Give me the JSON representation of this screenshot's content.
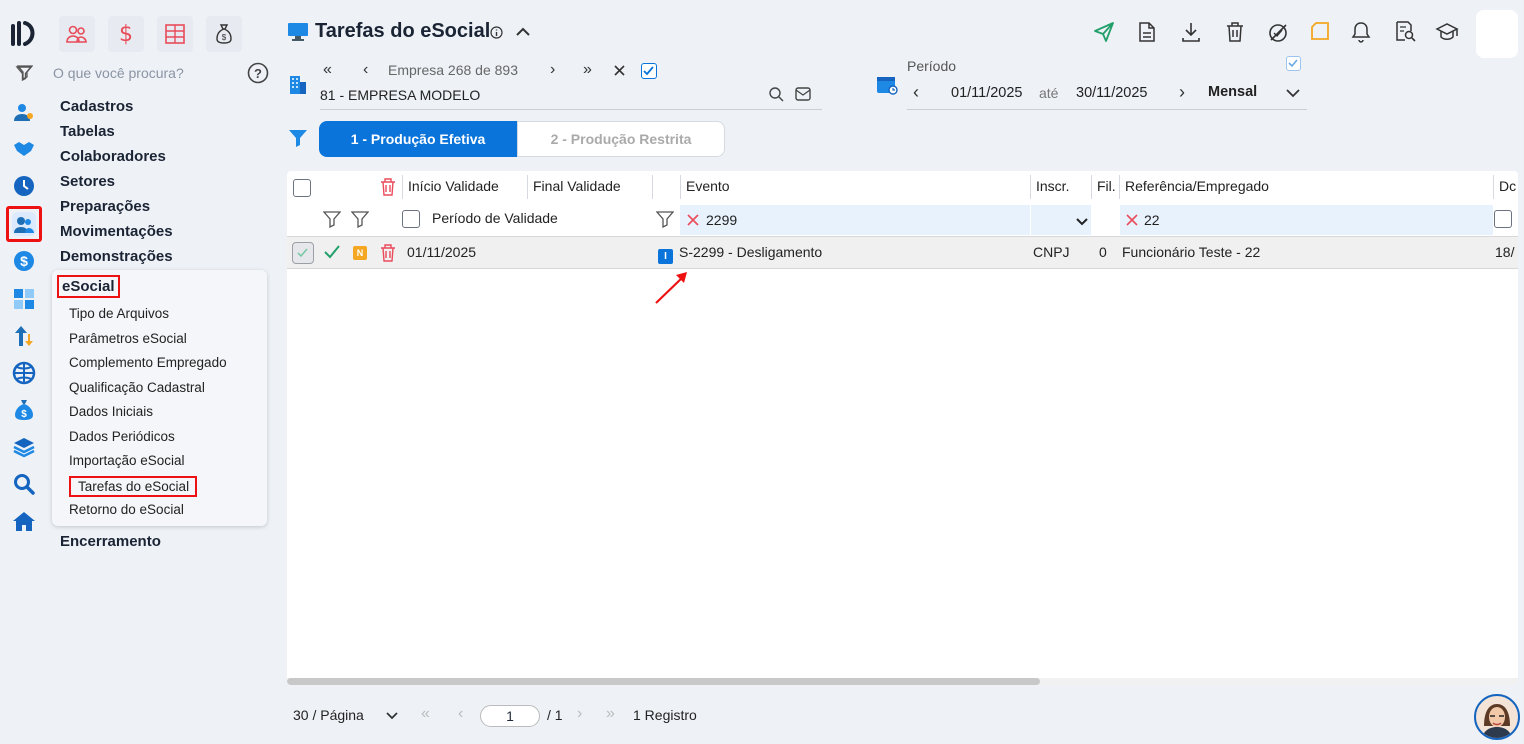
{
  "sidebar": {
    "search_placeholder": "O que você procura?",
    "menu": [
      "Cadastros",
      "Tabelas",
      "Colaboradores",
      "Setores",
      "Preparações",
      "Movimentações",
      "Demonstrações"
    ],
    "esocial_label": "eSocial",
    "submenu": [
      "Tipo de Arquivos",
      "Parâmetros eSocial",
      "Complemento Empregado",
      "Qualificação Cadastral",
      "Dados Iniciais",
      "Dados Periódicos",
      "Importação eSocial",
      "Tarefas do eSocial",
      "Retorno do eSocial"
    ],
    "encerramento": "Encerramento"
  },
  "header": {
    "title": "Tarefas do eSocial",
    "accent": "#0a74da"
  },
  "company": {
    "label": "Empresa",
    "index": "268",
    "of": "de",
    "total": "893",
    "name": "81 - EMPRESA MODELO"
  },
  "period": {
    "label": "Período",
    "start": "01/11/2025",
    "until": "até",
    "end": "30/11/2025",
    "mode": "Mensal"
  },
  "tabs": {
    "active": "1 - Produção Efetiva",
    "inactive": "2 - Produção Restrita"
  },
  "table": {
    "headers": {
      "inicio": "Início Validade",
      "final": "Final Validade",
      "evento": "Evento",
      "inscr": "Inscr.",
      "fil": "Fil.",
      "ref": "Referência/Empregado",
      "dc": "Dc"
    },
    "filters": {
      "periodo": "Período de Validade",
      "evento": "2299",
      "ref": "22"
    },
    "row": {
      "status_badge": "N",
      "inicio": "01/11/2025",
      "evento_badge": "I",
      "evento": "S-2299 - Desligamento",
      "inscr": "CNPJ",
      "fil": "0",
      "ref": "Funcionário Teste - 22",
      "dc": "18/"
    }
  },
  "pagination": {
    "per_page": "30 / Página",
    "page": "1",
    "pages": "/ 1",
    "records": "1 Registro"
  }
}
